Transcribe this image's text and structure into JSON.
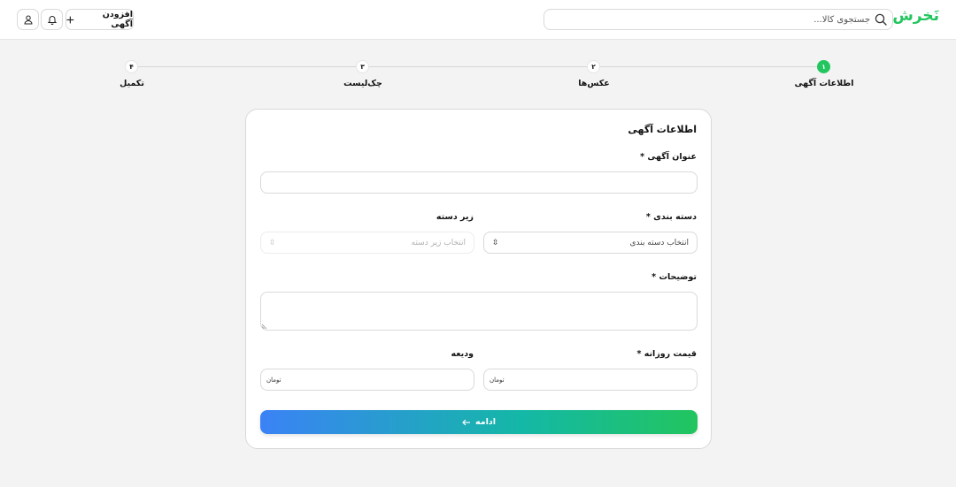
{
  "header": {
    "logo": "نَخرش",
    "search_placeholder": "جستجوی کالا...",
    "add_ad_label": "افزودن آگهی"
  },
  "steps": [
    {
      "number": "۱",
      "label": "اطلاعات آگهی",
      "active": true
    },
    {
      "number": "۲",
      "label": "عکس‌ها",
      "active": false
    },
    {
      "number": "۳",
      "label": "چک‌لیست",
      "active": false
    },
    {
      "number": "۴",
      "label": "تکمیل",
      "active": false
    }
  ],
  "form": {
    "title": "اطلاعات آگهی",
    "ad_title_label": "عنوان آگهی *",
    "ad_title_value": "",
    "category_label": "دسته بندی *",
    "category_placeholder": "انتخاب دسته بندی",
    "subcategory_label": "زیر دسته",
    "subcategory_placeholder": "انتخاب زیر دسته",
    "description_label": "توضیحات *",
    "description_value": "",
    "daily_price_label": "قیمت روزانه *",
    "daily_price_unit": "تومان",
    "deposit_label": "ودیعه",
    "deposit_unit": "تومان",
    "submit_label": "ادامه"
  },
  "colors": {
    "brand": "#22c55e",
    "gradient_start": "#3b82f6",
    "gradient_end": "#22c55e"
  }
}
